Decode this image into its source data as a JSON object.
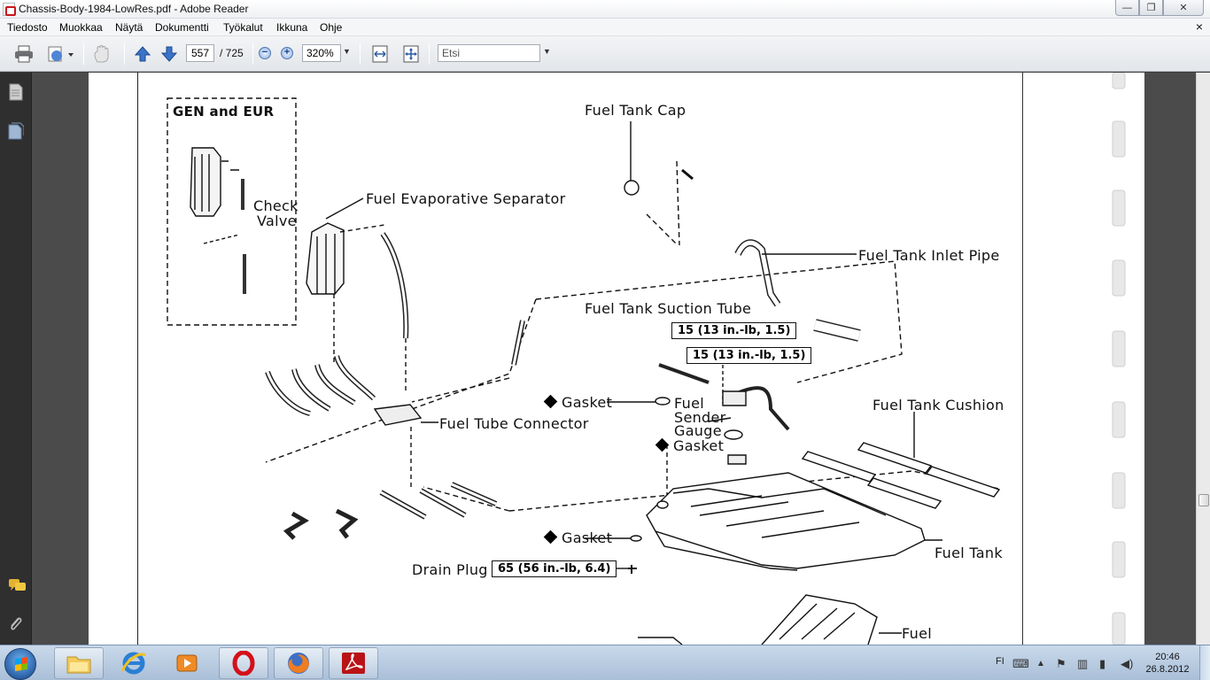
{
  "window": {
    "title": "Chassis-Body-1984-LowRes.pdf - Adobe Reader",
    "minimize": "—",
    "maximize": "❐",
    "close": "✕",
    "doc_close": "×"
  },
  "menu": [
    "Tiedosto",
    "Muokkaa",
    "Näytä",
    "Dokumentti",
    "Työkalut",
    "Ikkuna",
    "Ohje"
  ],
  "toolbar": {
    "page_current": "557",
    "page_total": "/ 725",
    "zoom_value": "320%",
    "zoom_out": "−",
    "zoom_in": "+",
    "search_placeholder": "Etsi"
  },
  "diagram": {
    "gen_eur": "GEN and EUR",
    "check": "Check",
    "valve": "Valve",
    "evap_separator": "Fuel Evaporative Separator",
    "tank_cap": "Fuel Tank Cap",
    "inlet_pipe": "Fuel Tank Inlet Pipe",
    "suction_tube": "Fuel Tank Suction Tube",
    "torque1": "15 (13 in.-lb, 1.5)",
    "torque2": "15 (13 in.-lb, 1.5)",
    "gasket1": "Gasket",
    "gasket2": "Gasket",
    "gasket3": "Gasket",
    "sender_line1": "Fuel",
    "sender_line2": "Sender",
    "sender_line3": "Gauge",
    "tube_connector": "Fuel Tube Connector",
    "tank_cushion": "Fuel Tank Cushion",
    "fuel_tank": "Fuel Tank",
    "drain_plug": "Drain Plug",
    "torque3": "65 (56 in.-lb, 6.4)",
    "fuel_bottom": "Fuel"
  },
  "taskbar": {
    "language": "FI",
    "time": "20:46",
    "date": "26.8.2012"
  },
  "colors": {
    "acrobat_red": "#c8171b",
    "toolbar_blue": "#2a5ca8",
    "nav_dark": "#2f2f2f"
  }
}
